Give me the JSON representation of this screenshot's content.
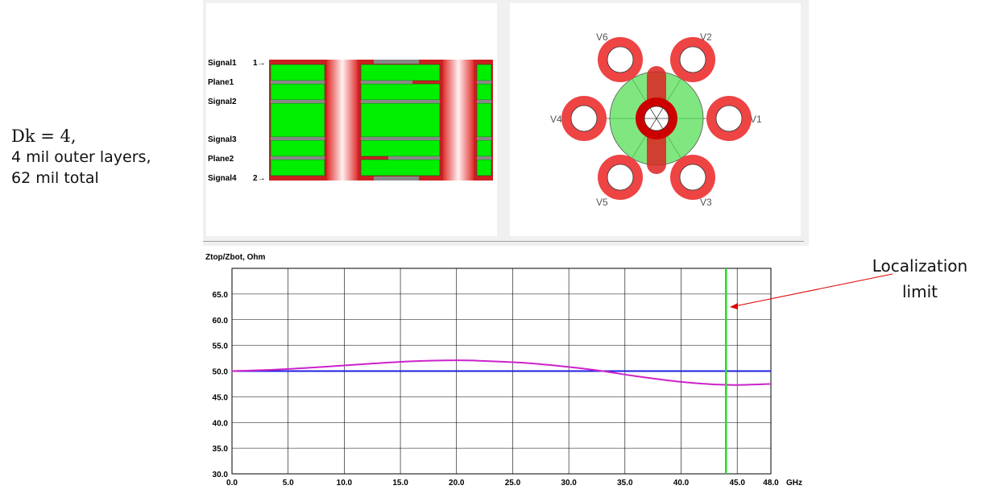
{
  "annotation": {
    "dk_math": "Dk = 4,",
    "line2": "4 mil outer layers,",
    "line3": "62 mil total"
  },
  "stackup": {
    "layers": [
      "Signal1",
      "Plane1",
      "Signal2",
      "Signal3",
      "Plane2",
      "Signal4"
    ],
    "port1": "1→",
    "port2": "2→"
  },
  "via_view": {
    "labels": [
      "V1",
      "V2",
      "V3",
      "V4",
      "V5",
      "V6"
    ]
  },
  "callout": {
    "line1": "Localization",
    "line2": "limit",
    "color": "#e00000"
  },
  "chart_data": {
    "type": "line",
    "ylabel": "Ztop/Zbot, Ohm",
    "xunit": "GHz",
    "xlim": [
      0,
      48
    ],
    "ylim": [
      30,
      70
    ],
    "xticks": [
      "0.0",
      "5.0",
      "10.0",
      "15.0",
      "20.0",
      "25.0",
      "30.0",
      "35.0",
      "40.0",
      "45.0",
      "48.0"
    ],
    "yticks": [
      "30.0",
      "35.0",
      "40.0",
      "45.0",
      "50.0",
      "55.0",
      "60.0",
      "65.0"
    ],
    "grid": true,
    "series": [
      {
        "color": "#2020e0",
        "x": [
          0,
          48
        ],
        "y": [
          50,
          50
        ]
      },
      {
        "color": "#cc22cc",
        "x": [
          0,
          4,
          8,
          12,
          16,
          20,
          22,
          26,
          30,
          33,
          36,
          40,
          43,
          45,
          48
        ],
        "y": [
          50.0,
          50.3,
          50.8,
          51.4,
          51.9,
          52.1,
          52.0,
          51.6,
          50.8,
          50.0,
          49.0,
          47.9,
          47.4,
          47.3,
          47.5
        ]
      }
    ],
    "marker_line": {
      "x": 44.0,
      "color": "#22dd22"
    }
  }
}
